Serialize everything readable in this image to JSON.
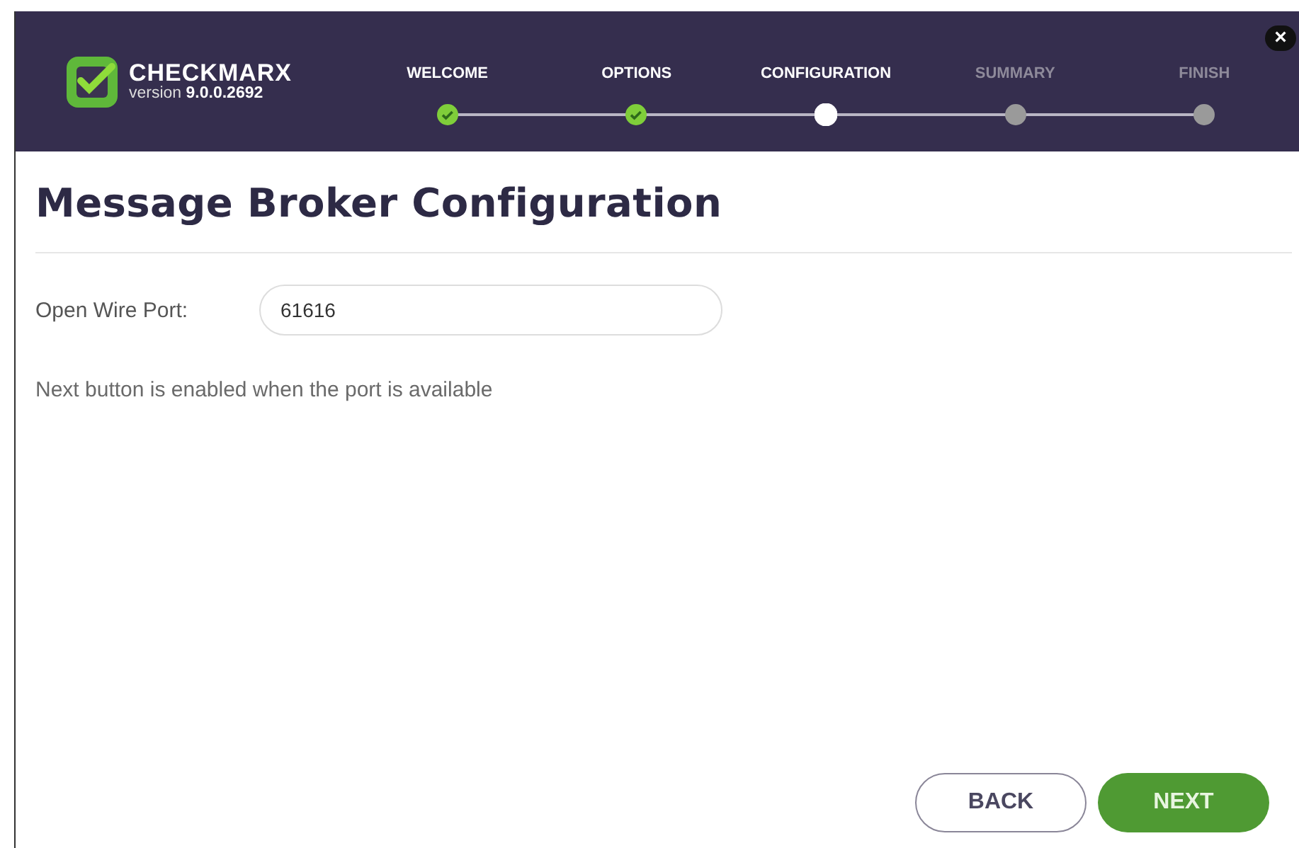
{
  "brand": {
    "name": "CHECKMARX",
    "version_label": "version",
    "version": "9.0.0.2692"
  },
  "steps": [
    {
      "label": "WELCOME",
      "completed": true,
      "selected": false
    },
    {
      "label": "OPTIONS",
      "completed": true,
      "selected": false
    },
    {
      "label": "CONFIGURATION",
      "completed": false,
      "selected": true
    },
    {
      "label": "SUMMARY",
      "completed": false,
      "selected": false
    },
    {
      "label": "FINISH",
      "completed": false,
      "selected": false
    }
  ],
  "close_button": "×",
  "title": "Message Broker Configuration",
  "field": {
    "label": "Open Wire Port:",
    "value": "61616"
  },
  "note": "Next button is enabled when the port is available",
  "buttons": {
    "back": "BACK",
    "next": "NEXT"
  }
}
